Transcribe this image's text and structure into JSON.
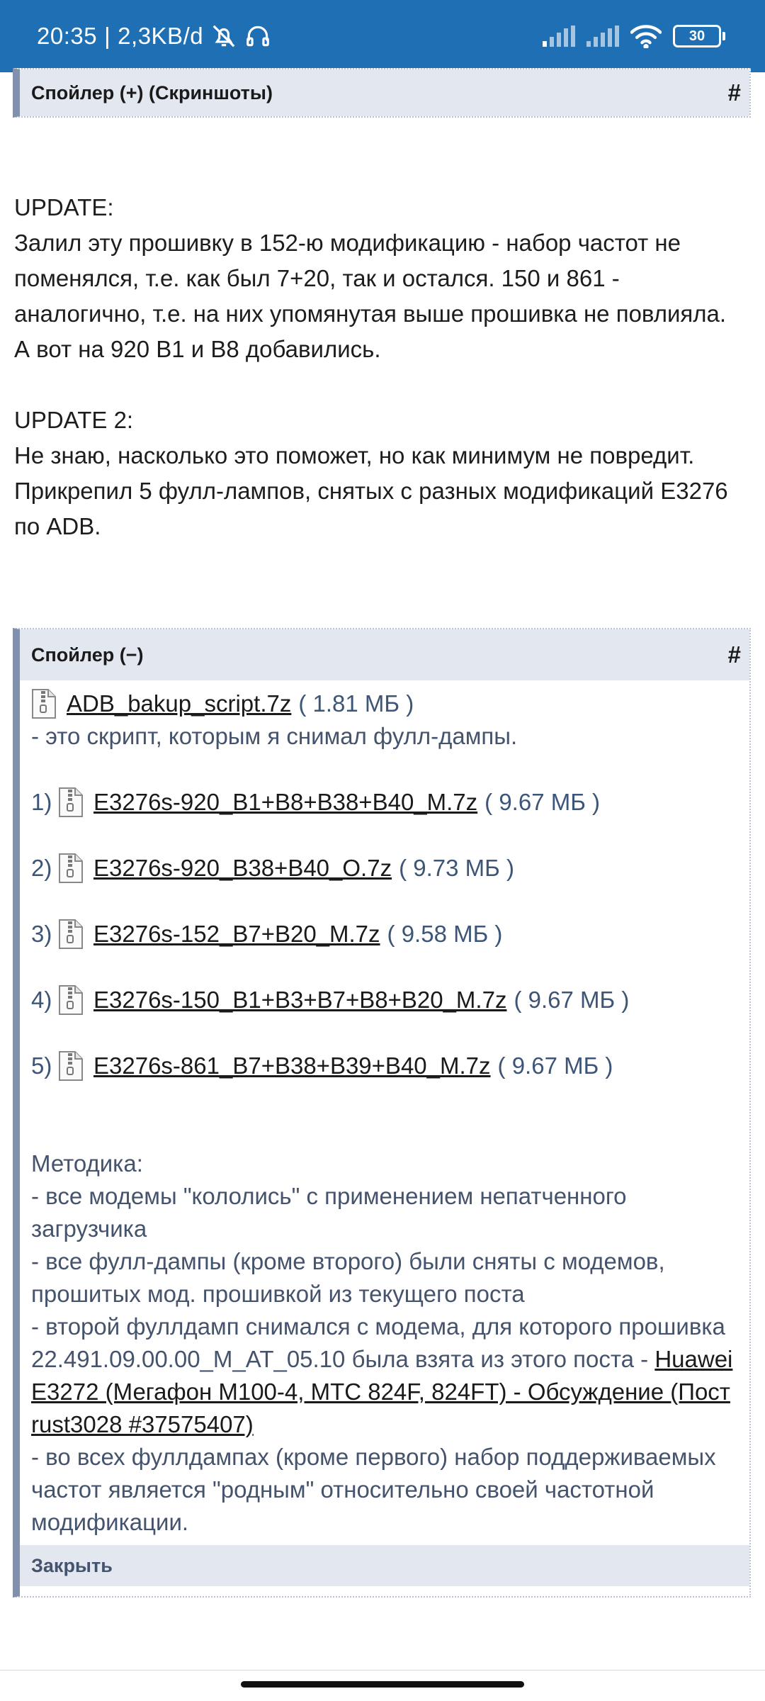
{
  "status_bar": {
    "time": "20:35",
    "separator": "|",
    "data_rate": "2,3KB/d",
    "icons": [
      "bell-off-icon",
      "headset-icon",
      "signal-icon",
      "signal-icon",
      "wifi-icon"
    ],
    "battery": "30",
    "colors": {
      "bar": "#1f6fb5"
    }
  },
  "spoiler_top": {
    "title": "Спойлер (+) (Скриншоты)",
    "anchor": "#"
  },
  "post": {
    "update1_heading": "UPDATE:",
    "update1_line1": "Залил эту прошивку в 152-ю модификацию - набор частот не поменялся, т.е. как был 7+20, так и остался. 150 и 861 - аналогично, т.е. на них упомянутая выше прошивка не повлияла.",
    "update1_line2": "А вот на 920 B1 и B8 добавились.",
    "update2_heading": "UPDATE 2:",
    "update2_line1": "Не знаю, насколько это поможет, но как минимум не повредит. Прикрепил 5 фулл-лампов, снятых с разных модификаций E3276 по ADB."
  },
  "spoiler_main": {
    "title": "Спойлер (−)",
    "anchor": "#",
    "script_file": {
      "name": "ADB_bakup_script.7z",
      "size": "( 1.81 МБ )"
    },
    "script_note": "- это скрипт, которым я снимал фулл-дампы.",
    "files": [
      {
        "num": "1)",
        "name": "E3276s-920_B1+B8+B38+B40_M.7z",
        "size": "( 9.67 МБ )"
      },
      {
        "num": "2)",
        "name": "E3276s-920_B38+B40_O.7z",
        "size": "( 9.73 МБ )"
      },
      {
        "num": "3)",
        "name": "E3276s-152_B7+B20_M.7z",
        "size": "( 9.58 МБ )"
      },
      {
        "num": "4)",
        "name": "E3276s-150_B1+B3+B7+B8+B20_M.7z",
        "size": "( 9.67 МБ )"
      },
      {
        "num": "5)",
        "name": "E3276s-861_B7+B38+B39+B40_M.7z",
        "size": "( 9.67 МБ )"
      }
    ],
    "method_heading": "Методика:",
    "method_1": "- все модемы \"кололись\" с применением непатченного загрузчика",
    "method_2": "- все фулл-дампы (кроме второго) были сняты с модемов, прошитых мод. прошивкой из текущего поста",
    "method_3_text": "- второй фуллдамп снимался с модема, для которого прошивка 22.491.09.00.00_M_AT_05.10 была взята из этого поста - ",
    "method_3_link": "Huawei E3272 (Мегафон М100-4, МТС 824F, 824FT) - Обсуждение (Пост rust3028 #37575407)",
    "method_4": "- во всех фуллдампах (кроме первого) набор поддерживаемых частот является \"родным\" относительно своей частотной модификации.",
    "close_label": "Закрыть"
  }
}
